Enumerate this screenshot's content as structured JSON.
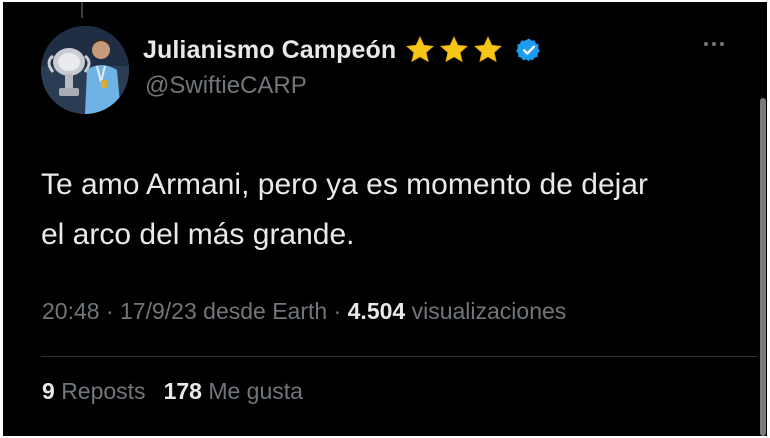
{
  "author": {
    "display_name": "Julianismo Campeón",
    "handle": "@SwiftieCARP",
    "badges": [
      "star-icon",
      "star-icon",
      "star-icon",
      "verified-badge-icon"
    ]
  },
  "tweet": {
    "text": "Te amo Armani, pero ya es momento de dejar\nel arco del más grande."
  },
  "meta": {
    "time": "20:48",
    "date": "17/9/23",
    "source": "desde Earth",
    "views_count": "4.504",
    "views_label": "visualizaciones"
  },
  "stats": {
    "reposts_count": "9",
    "reposts_label": "Reposts",
    "likes_count": "178",
    "likes_label": "Me gusta"
  },
  "colors": {
    "background": "#000000",
    "text_primary": "#e7e9ea",
    "text_secondary": "#71767b",
    "divider": "#2f3336",
    "verified": "#1d9bf0",
    "star": "#f5c518"
  }
}
